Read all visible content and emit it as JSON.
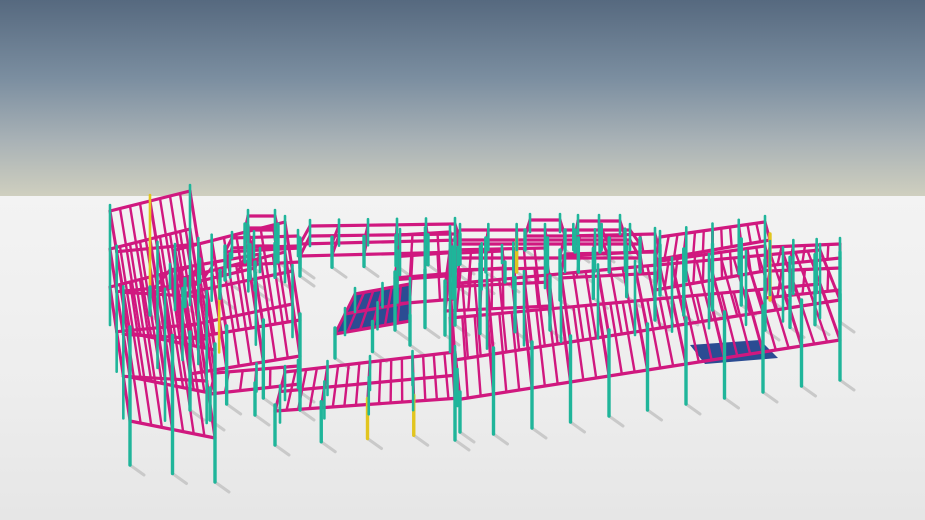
{
  "scene": {
    "sky_top": "#56697f",
    "sky_horizon": "#cfcfbf",
    "ground": "#efefef"
  },
  "colors": {
    "column": "#1fb59a",
    "beam": "#d0187f",
    "brace": "#e2c51e",
    "slab": "#153a88",
    "shadow": "#c9c9c9"
  }
}
